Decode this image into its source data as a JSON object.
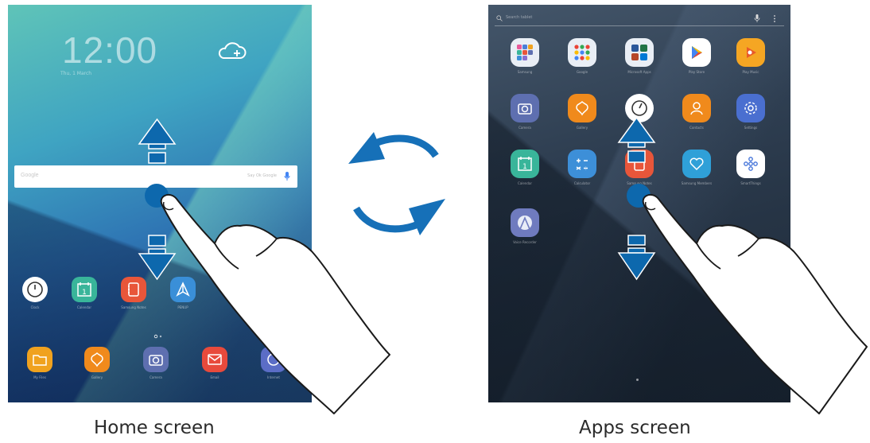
{
  "captions": {
    "home": "Home screen",
    "apps": "Apps screen"
  },
  "home_screen": {
    "clock": "12:00",
    "date": "Thu, 1 March",
    "search_logo": "Google",
    "search_hint": "Say Ok Google",
    "dock_icons": [
      {
        "name": "clock",
        "label": "Clock",
        "color": "#ffffff"
      },
      {
        "name": "calendar",
        "label": "Calendar",
        "color": "#39b59a"
      },
      {
        "name": "notes",
        "label": "Samsung Notes",
        "color": "#e8563a"
      },
      {
        "name": "share",
        "label": "PENUP",
        "color": "#3a8fd8"
      }
    ],
    "bottom_icons": [
      {
        "name": "my-files",
        "label": "My Files",
        "color": "#f0a21f"
      },
      {
        "name": "gallery",
        "label": "Gallery",
        "color": "#f08a1c"
      },
      {
        "name": "camera",
        "label": "Camera",
        "color": "#5e6fb0"
      },
      {
        "name": "email",
        "label": "Email",
        "color": "#e84a3c"
      },
      {
        "name": "internet",
        "label": "Internet",
        "color": "#5b6dc6"
      }
    ]
  },
  "apps_screen": {
    "search_placeholder": "Search tablet",
    "apps": [
      {
        "name": "samsung",
        "label": "Samsung",
        "color": "#e9eef5"
      },
      {
        "name": "google",
        "label": "Google",
        "color": "#e9eef5"
      },
      {
        "name": "microsoft-apps",
        "label": "Microsoft Apps",
        "color": "#e9eef5"
      },
      {
        "name": "play-store",
        "label": "Play Store",
        "color": "#ffffff"
      },
      {
        "name": "play-music",
        "label": "Play Music",
        "color": "#f5a623"
      },
      {
        "name": "camera",
        "label": "Camera",
        "color": "#5e6fb0"
      },
      {
        "name": "gallery",
        "label": "Gallery",
        "color": "#f08a1c"
      },
      {
        "name": "clock",
        "label": "Clock",
        "color": "#ffffff"
      },
      {
        "name": "contacts",
        "label": "Contacts",
        "color": "#f08a1c"
      },
      {
        "name": "settings",
        "label": "Settings",
        "color": "#4a6fd0"
      },
      {
        "name": "calendar",
        "label": "Calendar",
        "color": "#39b59a"
      },
      {
        "name": "calculator",
        "label": "Calculator",
        "color": "#3d8fd8"
      },
      {
        "name": "samsung-notes",
        "label": "Samsung Notes",
        "color": "#e8563a"
      },
      {
        "name": "samsung-members",
        "label": "Samsung Members",
        "color": "#2fa0d8"
      },
      {
        "name": "smartthings",
        "label": "SmartThings",
        "color": "#ffffff"
      },
      {
        "name": "voice-recorder",
        "label": "Voice Recorder",
        "color": "#6f7bbf"
      }
    ]
  },
  "colors": {
    "swipe_blue": "#0d68ad",
    "cycle_blue": "#1670b8"
  }
}
